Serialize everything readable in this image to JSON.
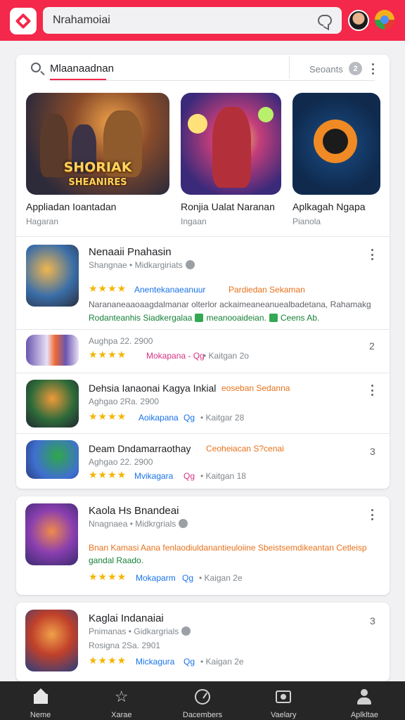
{
  "header": {
    "search_text": "Nrahamoiai",
    "colors": {
      "bar": "#f4284a"
    }
  },
  "search": {
    "query": "Mlaanaadnan",
    "filter_label": "Seoants",
    "badge": "2"
  },
  "featured": [
    {
      "title": "Appliadan Ioantadan",
      "subtitle": "Hagaran",
      "art_title": "SHORIAK",
      "art_subtitle": "SHEANIRES"
    },
    {
      "title": "Ronjia Ualat Naranan",
      "subtitle": "Ingaan"
    },
    {
      "title": "Aplkagah Ngapa",
      "subtitle": "Pianola"
    }
  ],
  "apps": [
    {
      "title": "Nenaaii Pnahasin",
      "meta": "Shangnae • Midkargiriats",
      "stars": "★★★★",
      "tag1": "Anentekanaeanuur",
      "tag2": "Pardiedan Sekaman",
      "desc": "Narananeaaoaagdalmanar olterlor ackaimeaneanuealbadetana, Rahamakg",
      "extra1": "Rodanteanhis Siadkergalaa",
      "extra2": "meanooaideian.",
      "extra3": "Ceens Ab."
    },
    {
      "meta": "Aughpa 22. 2900",
      "stars": "★★★★",
      "tag1": "Mokapana - Qg",
      "tag2": "• Kaitgan 2o"
    },
    {
      "title": "Dehsia Ianaonai Kagya Inkial",
      "tag_inline": "eoseban Sedanna",
      "meta": "Aghgao 2Ra. 2900",
      "stars": "★★★★",
      "tag1": "Aoikapana",
      "tag2": "Qg",
      "tag3": "• Kaitgar 28"
    },
    {
      "title": "Deam Dndamarraothay",
      "tag_inline": "Ceoheiacan S?cenai",
      "meta": "Aghgao 22. 2900",
      "stars": "★★★★",
      "tag1": "Mvikagara",
      "tag2": "Qg",
      "tag3": "• Kaitgan 18"
    },
    {
      "title": "Kaola Hs Bnandeai",
      "meta": "Nnagnaea • Midkrgrials",
      "desc1": "Bnan Kamasi Aana fenlaodiuldanantieuloiine Sbeistsemdikeantan Cetleisp",
      "desc2": "gandal Raado.",
      "stars": "★★★★",
      "tag1": "Mokaparm",
      "tag2": "Qg",
      "tag3": "• Kaigan 2e"
    },
    {
      "title": "Kaglai Indanaiai",
      "meta1": "Pnimanas • Gidkargrials",
      "meta2": "Rosigna 2Sa. 2901",
      "stars": "★★★★",
      "tag1": "Mickagura",
      "tag2": "Qg",
      "tag3": "• Kaigan 2e"
    }
  ],
  "side_numbers": {
    "row2": "2",
    "row4": "3",
    "card3": "3"
  },
  "nav": [
    {
      "label": "Neme",
      "icon": "home-icon"
    },
    {
      "label": "Xarae",
      "icon": "star-icon"
    },
    {
      "label": "Dacembers",
      "icon": "gauge-icon"
    },
    {
      "label": "Vaelary",
      "icon": "camera-icon"
    },
    {
      "label": "Aplkltae",
      "icon": "person-icon"
    }
  ]
}
